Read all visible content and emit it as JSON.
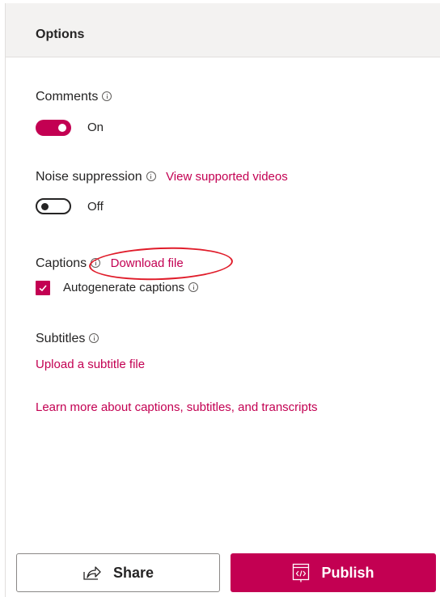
{
  "header": {
    "title": "Options"
  },
  "comments": {
    "label": "Comments",
    "state_label": "On",
    "enabled": true
  },
  "noise": {
    "label": "Noise suppression",
    "link": "View supported videos",
    "state_label": "Off",
    "enabled": false
  },
  "captions": {
    "label": "Captions",
    "link": "Download file",
    "checkbox_label": "Autogenerate captions",
    "checked": true
  },
  "subtitles": {
    "label": "Subtitles",
    "link": "Upload a subtitle file"
  },
  "learn_more": "Learn more about captions, subtitles, and transcripts",
  "actions": {
    "share": "Share",
    "publish": "Publish"
  },
  "colors": {
    "accent": "#c30052",
    "annotation": "#e01c2a",
    "header_bg": "#f3f2f1"
  },
  "icons": [
    "info-icon",
    "check-icon",
    "share-icon",
    "publish-embed-icon"
  ]
}
